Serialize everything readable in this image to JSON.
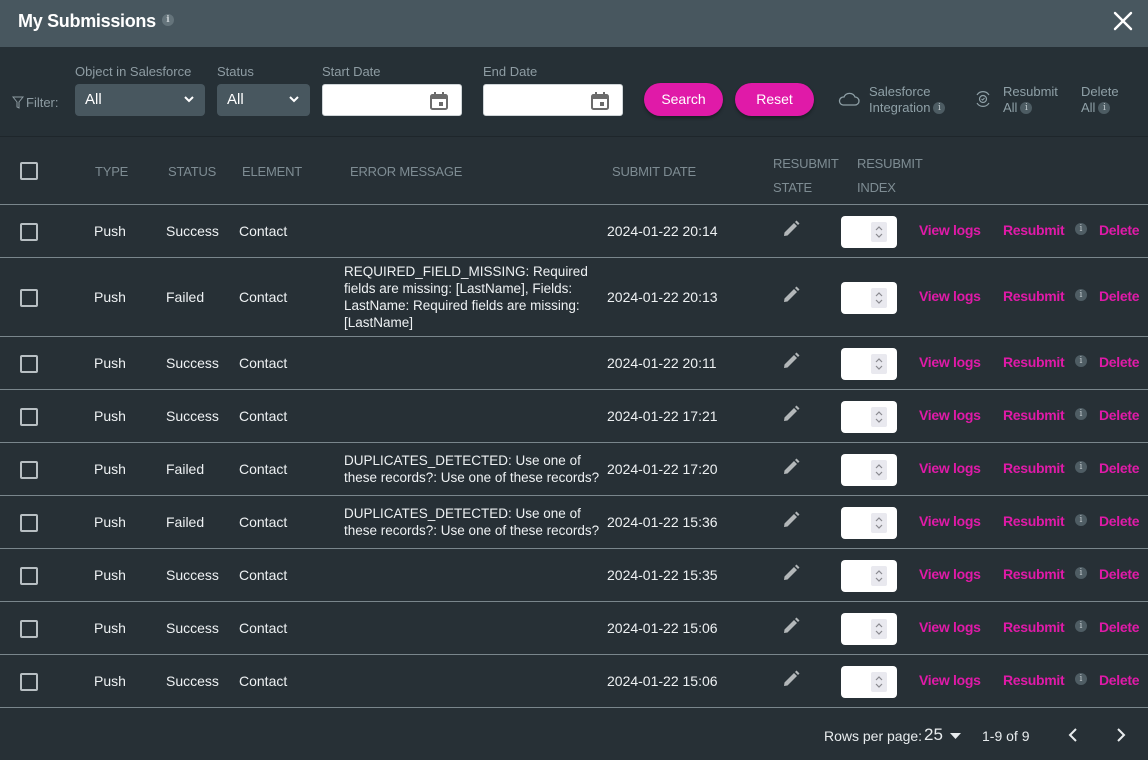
{
  "window": {
    "title": "My Submissions",
    "info": "i",
    "close": "close"
  },
  "filters": {
    "label": "Filter:",
    "object": {
      "label": "Object in Salesforce",
      "value": "All"
    },
    "status": {
      "label": "Status",
      "value": "All"
    },
    "start_date": {
      "label": "Start Date",
      "value": ""
    },
    "end_date": {
      "label": "End Date",
      "value": ""
    },
    "search_label": "Search",
    "reset_label": "Reset",
    "tools": {
      "salesforce_integration": [
        "Salesforce",
        "Integration"
      ],
      "resubmit_all": [
        "Resubmit",
        "All"
      ],
      "delete_all": [
        "Delete",
        "All"
      ]
    }
  },
  "colors": {
    "accent": "#e01aa8",
    "header_bg": "#48575f",
    "body_bg": "#273036"
  },
  "table": {
    "columns": {
      "type": "TYPE",
      "status": "STATUS",
      "element": "ELEMENT",
      "error_message": "ERROR MESSAGE",
      "submit_date": "SUBMIT DATE",
      "resubmit_state": [
        "RESUBMIT",
        "STATE"
      ],
      "resubmit_index": [
        "RESUBMIT",
        "INDEX"
      ]
    },
    "actions": {
      "view_logs": "View logs",
      "resubmit": "Resubmit",
      "delete": "Delete"
    },
    "rows": [
      {
        "type": "Push",
        "status": "Success",
        "element": "Contact",
        "error": "",
        "date": "2024-01-22 20:14",
        "index": ""
      },
      {
        "type": "Push",
        "status": "Failed",
        "element": "Contact",
        "error": "REQUIRED_FIELD_MISSING: Required fields are missing: [LastName], Fields: LastName: Required fields are missing: [LastName]",
        "date": "2024-01-22 20:13",
        "index": ""
      },
      {
        "type": "Push",
        "status": "Success",
        "element": "Contact",
        "error": "",
        "date": "2024-01-22 20:11",
        "index": ""
      },
      {
        "type": "Push",
        "status": "Success",
        "element": "Contact",
        "error": "",
        "date": "2024-01-22 17:21",
        "index": ""
      },
      {
        "type": "Push",
        "status": "Failed",
        "element": "Contact",
        "error": "DUPLICATES_DETECTED: Use one of these records?: Use one of these records?",
        "date": "2024-01-22 17:20",
        "index": ""
      },
      {
        "type": "Push",
        "status": "Failed",
        "element": "Contact",
        "error": "DUPLICATES_DETECTED: Use one of these records?: Use one of these records?",
        "date": "2024-01-22 15:36",
        "index": ""
      },
      {
        "type": "Push",
        "status": "Success",
        "element": "Contact",
        "error": "",
        "date": "2024-01-22 15:35",
        "index": ""
      },
      {
        "type": "Push",
        "status": "Success",
        "element": "Contact",
        "error": "",
        "date": "2024-01-22 15:06",
        "index": ""
      },
      {
        "type": "Push",
        "status": "Success",
        "element": "Contact",
        "error": "",
        "date": "2024-01-22 15:06",
        "index": ""
      }
    ]
  },
  "pagination": {
    "rows_per_page_label": "Rows per page:",
    "rows_per_page": "25",
    "range": "1-9 of 9"
  }
}
